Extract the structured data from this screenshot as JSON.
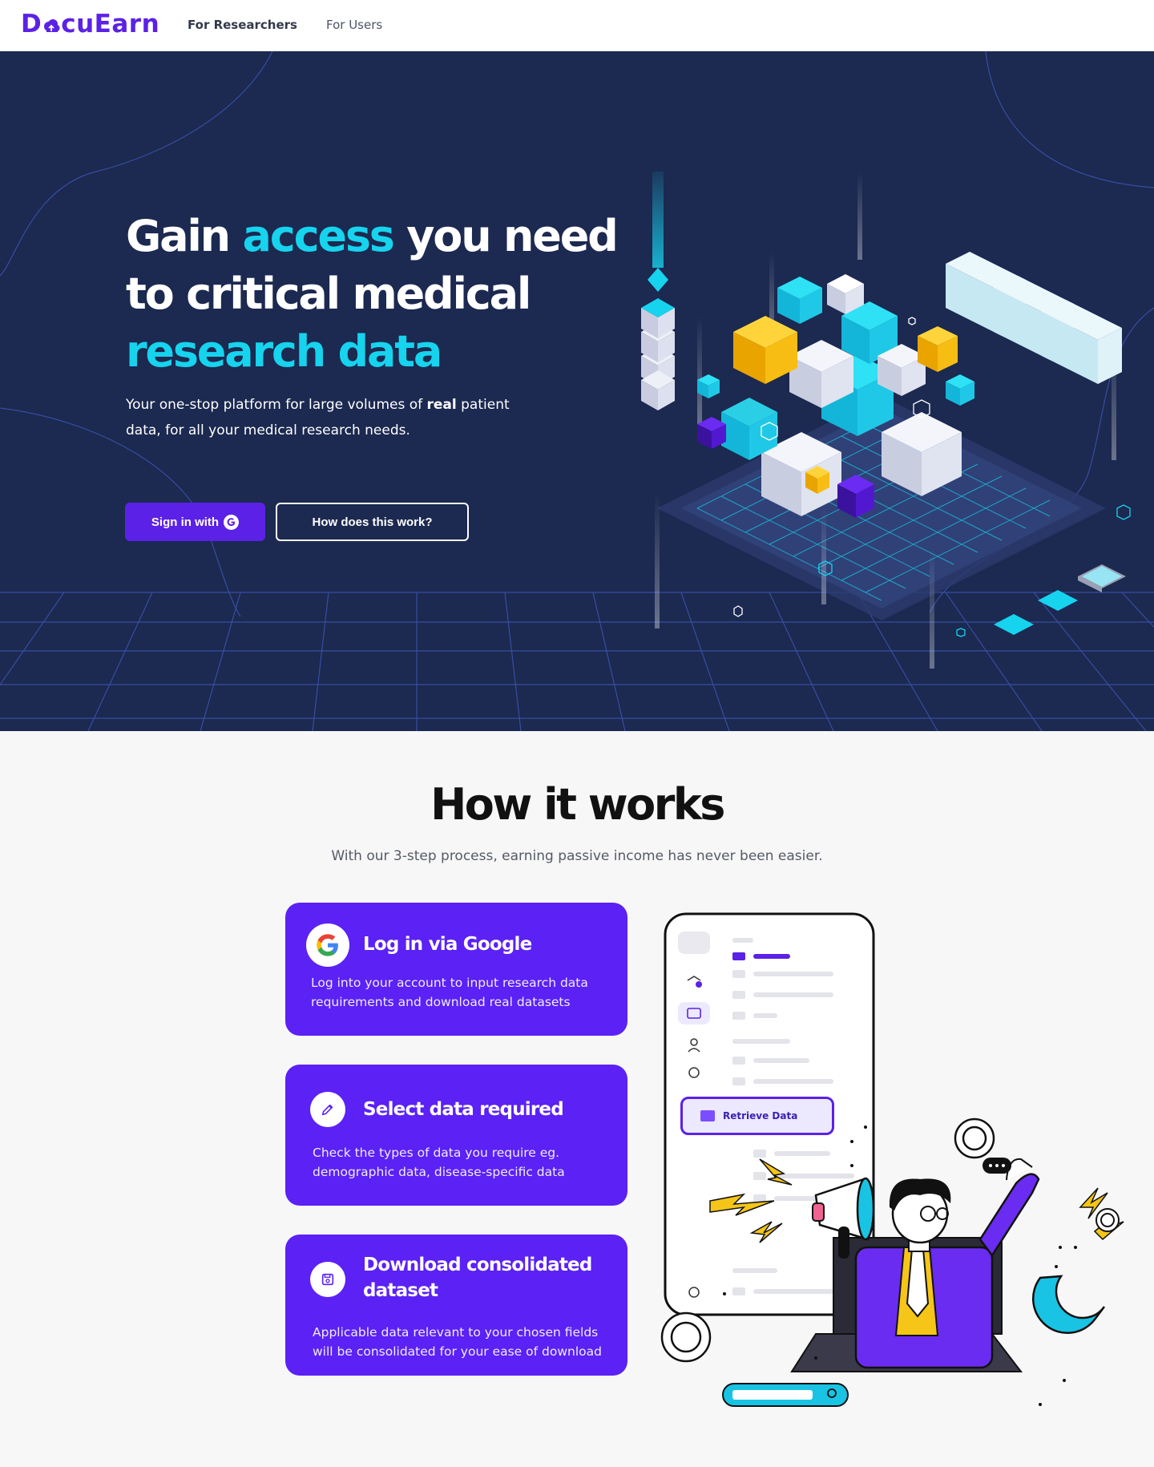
{
  "brand": {
    "name_pre": "D",
    "name_post": "cuEarn",
    "color": "#5b21e6"
  },
  "nav": {
    "researchers": "For Researchers",
    "users": "For  Users"
  },
  "hero": {
    "title_1": "Gain ",
    "title_accent_1": "access",
    "title_2": " you need to critical medical ",
    "title_accent_2": "research data",
    "subtitle_pre": "Your one-stop platform for large volumes of ",
    "subtitle_bold": "real",
    "subtitle_post": " patient data, for all your medical research needs.",
    "signin_label": "Sign in with",
    "how_label": "How does this work?",
    "bg_color": "#1c2950",
    "accent_color": "#16d3ee"
  },
  "how": {
    "title": "How it works",
    "subtitle": "With our  3-step process, earning passive income has never been easier.",
    "steps": [
      {
        "title": "Log in via Google",
        "desc": "Log into your account to input research data requirements and download real datasets",
        "icon": "google-icon"
      },
      {
        "title": "Select data required",
        "desc": "Check the types of data you require eg. demographic data, disease-specific data",
        "icon": "pencil-icon"
      },
      {
        "title": "Download consolidated dataset",
        "desc": "Applicable data relevant to your chosen fields will be consolidated for your ease of download",
        "icon": "save-icon"
      }
    ],
    "card_color": "#5b21f5"
  },
  "illustration": {
    "retrieve_label": "Retrieve Data"
  }
}
